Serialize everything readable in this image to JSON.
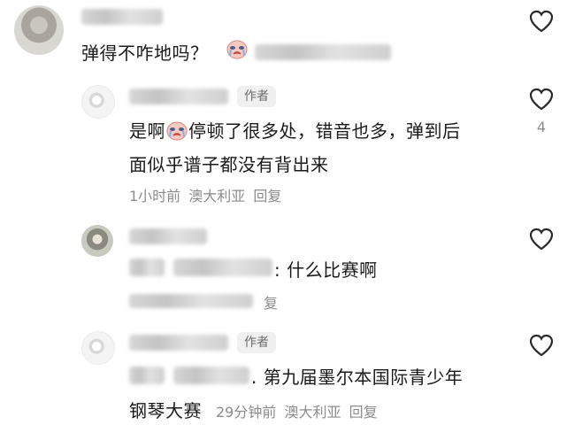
{
  "comments": {
    "c1": {
      "text": "弹得不咋地吗？",
      "like_icon": "heart-outline-icon"
    },
    "c2": {
      "author_badge": "作者",
      "text_line1_after_emoji": "停顿了很多处，错音也多，弹到后",
      "text_line1_prefix": "是啊",
      "text_line2": "面似乎谱子都没有背出来",
      "time": "1小时前",
      "location": "澳大利亚",
      "reply": "回复",
      "like_count": "4"
    },
    "c3": {
      "text": "什么比赛啊",
      "reply": "复"
    },
    "c4": {
      "author_badge": "作者",
      "text_line1": ". 第九届墨尔本国际青少年",
      "text_line2": "钢琴大赛",
      "time": "29分钟前",
      "location": "澳大利亚",
      "reply": "回复"
    }
  },
  "icons": {
    "like": "heart-outline-icon",
    "emoji": "crying-face-emoji"
  },
  "colors": {
    "meta_gray": "#8c8c8c",
    "badge_bg": "#f0f0f0",
    "heart_stroke": "#2a2a2a"
  }
}
